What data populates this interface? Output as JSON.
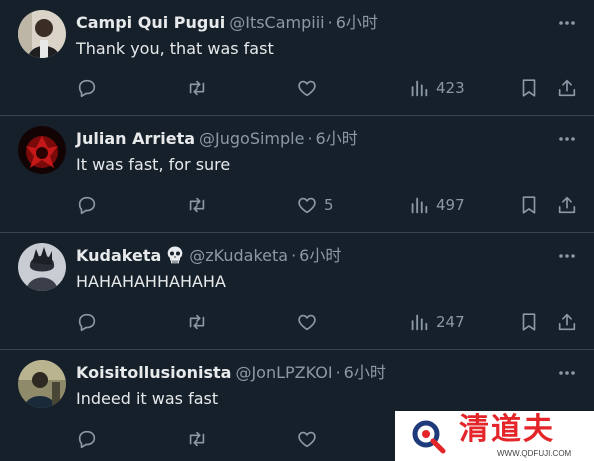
{
  "tweets": [
    {
      "name": "Campi Qui Pugui",
      "handle": "@ItsCampiii",
      "time": "6小时",
      "text": "Thank you, that was fast",
      "likes": "",
      "views": "423"
    },
    {
      "name": "Julian Arrieta",
      "handle": "@JugoSimple",
      "time": "6小时",
      "text": "It was fast, for sure",
      "likes": "5",
      "views": "497"
    },
    {
      "name": "Kudaketa",
      "handle": "@zKudaketa",
      "time": "6小时",
      "text": "HAHAHAHHAHAHA",
      "likes": "",
      "views": "247"
    },
    {
      "name": "Koisitollusionista",
      "handle": "@JonLPZKOI",
      "time": "6小时",
      "text": "Indeed it was fast",
      "likes": "",
      "views": ""
    }
  ],
  "separator": "·",
  "icons": {
    "reply": "reply-icon",
    "retweet": "retweet-icon",
    "like": "heart-icon",
    "views": "views-chart-icon",
    "bookmark": "bookmark-icon",
    "share": "share-icon",
    "more": "more-icon",
    "name_emoji": "skull-icon"
  },
  "watermark": {
    "title": "清道夫",
    "url": "WWW.QDFUJI.COM"
  },
  "colors": {
    "background": "#15202b",
    "text_primary": "#e7e9ea",
    "text_secondary": "#8b98a5",
    "divider": "#38444d",
    "watermark_red": "#e4262a"
  }
}
